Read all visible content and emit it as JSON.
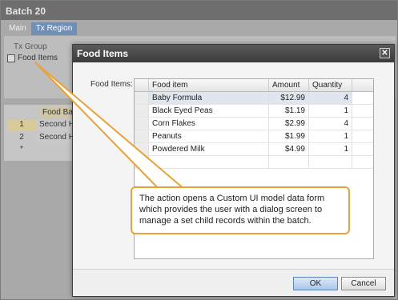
{
  "background": {
    "window_title": "Batch 20",
    "tabs": [
      {
        "label": "Main"
      },
      {
        "label": "Tx Region"
      }
    ],
    "group_label": "Tx Group",
    "group_item": "Food Items",
    "grid": {
      "header": "Food Bat",
      "rows": [
        {
          "num": "1",
          "value": "Second H"
        },
        {
          "num": "2",
          "value": "Second H"
        },
        {
          "num": "*",
          "value": ""
        }
      ]
    }
  },
  "dialog": {
    "title": "Food Items",
    "close_glyph": "✕",
    "field_label": "Food Items:",
    "columns": {
      "item": "Food item",
      "amount": "Amount",
      "quantity": "Quantity"
    },
    "rows": [
      {
        "item": "Baby Formula",
        "amount": "$12.99",
        "quantity": "4"
      },
      {
        "item": "Black Eyed Peas",
        "amount": "$1.19",
        "quantity": "1"
      },
      {
        "item": "Corn Flakes",
        "amount": "$2.99",
        "quantity": "4"
      },
      {
        "item": "Peanuts",
        "amount": "$1.99",
        "quantity": "1"
      },
      {
        "item": "Powdered Milk",
        "amount": "$4.99",
        "quantity": "1"
      }
    ],
    "new_row_marker": "*",
    "ok_label": "OK",
    "cancel_label": "Cancel"
  },
  "callout": {
    "text": "The action opens a Custom UI model  data form which provides the user with a dialog screen to manage a set child records within the batch."
  },
  "colors": {
    "callout_border": "#e8a237",
    "selection": "#dfe6ef",
    "titlebar": "#3b3b3b"
  }
}
